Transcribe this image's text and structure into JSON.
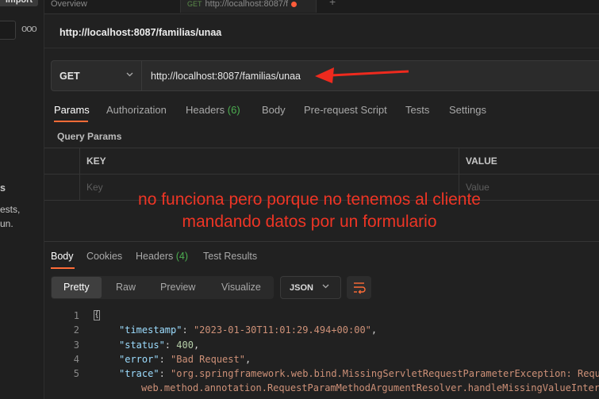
{
  "sidebar": {
    "import_label": "Import",
    "more_label": "ooo",
    "empty_title": "s",
    "empty_line1": "ests,",
    "empty_line2": "un."
  },
  "tabs": {
    "overview_label": "Overview",
    "request_method": "GET",
    "request_label": "http://localhost:8087/f"
  },
  "request": {
    "title": "http://localhost:8087/familias/unaa",
    "method": "GET",
    "url": "http://localhost:8087/familias/unaa"
  },
  "request_tabs": [
    {
      "label": "Params"
    },
    {
      "label": "Authorization"
    },
    {
      "label": "Headers",
      "count": "(6)"
    },
    {
      "label": "Body"
    },
    {
      "label": "Pre-request Script"
    },
    {
      "label": "Tests"
    },
    {
      "label": "Settings"
    }
  ],
  "query_params": {
    "label": "Query Params",
    "col_key": "KEY",
    "col_value": "VALUE",
    "key_placeholder": "Key",
    "value_placeholder": "Value"
  },
  "annotation": {
    "line1": "no funciona pero porque no tenemos al cliente",
    "line2": "mandando datos por un formulario",
    "color": "#ee3525"
  },
  "response_tabs": [
    {
      "label": "Body"
    },
    {
      "label": "Cookies"
    },
    {
      "label": "Headers",
      "count": "(4)"
    },
    {
      "label": "Test Results"
    }
  ],
  "view_modes": [
    "Pretty",
    "Raw",
    "Preview",
    "Visualize"
  ],
  "format": "JSON",
  "response_body": {
    "lines": [
      {
        "n": "1",
        "text": "{"
      },
      {
        "n": "2",
        "key": "\"timestamp\"",
        "value": "\"2023-01-30T11:01:29.494+00:00\"",
        "tail": ","
      },
      {
        "n": "3",
        "key": "\"status\"",
        "value": "400",
        "tail": ","
      },
      {
        "n": "4",
        "key": "\"error\"",
        "value": "\"Bad Request\"",
        "tail": ","
      },
      {
        "n": "5",
        "key": "\"trace\"",
        "value": "\"org.springframework.web.bind.MissingServletRequestParameterException: Requ"
      },
      {
        "n": "",
        "value": "web.method.annotation.RequestParamMethodArgumentResolver.handleMissingValueInter"
      }
    ]
  },
  "accent_color": "#ff6c37"
}
